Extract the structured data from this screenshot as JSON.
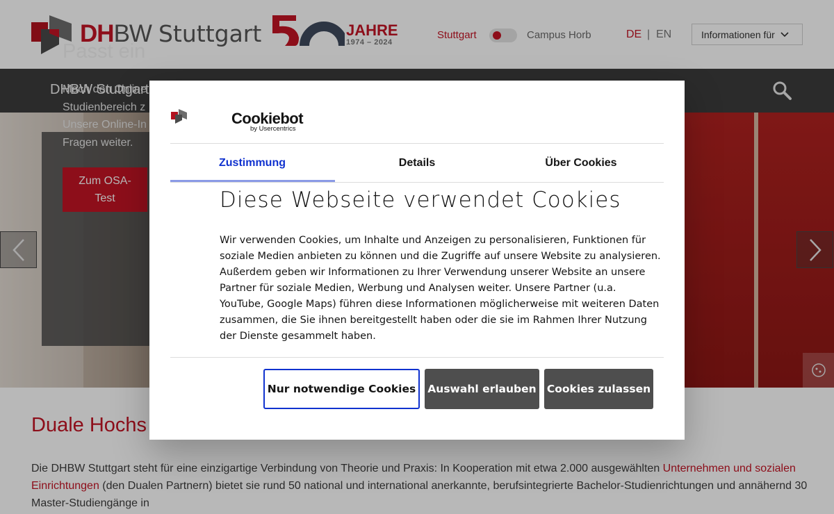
{
  "header": {
    "brand_dh": "DH",
    "brand_bw": "BW",
    "brand_city": "Stuttgart",
    "jubilee_label": "JAHRE",
    "jubilee_years": "1974 – 2024",
    "campus_stuttgart": "Stuttgart",
    "campus_horb": "Campus Horb",
    "lang_de": "DE",
    "lang_sep": "|",
    "lang_en": "EN",
    "info_dropdown": "Informationen für"
  },
  "nav": {
    "title": "DHBW Stuttgart"
  },
  "hero": {
    "title": "Passt ein",
    "lines": [
      "Mach den Online",
      "Studienbereich z",
      "Unsere Online-In",
      "Fragen weiter."
    ],
    "button_line1": "Zum OSA-",
    "button_line2": "Test"
  },
  "content": {
    "title": "Duale Hochs",
    "text_part1": "Die DHBW Stuttgart steht für eine einzigartige Verbindung von Theorie und Praxis: In Kooperation mit etwa 2.000 ausgewählten ",
    "text_link": "Unternehmen und sozialen Einrichtungen",
    "text_part2": " (den Dualen Partnern) bietet sie rund 50 national und international anerkannte, berufsintegrierte Bachelor-Studienrichtungen und annähernd 30 Master-Studiengänge in"
  },
  "cookie_dialog": {
    "brand": "Cookiebot",
    "brand_sub": "by Usercentrics",
    "tabs": [
      "Zustimmung",
      "Details",
      "Über Cookies"
    ],
    "heading": "Diese Webseite verwendet Cookies",
    "body": "Wir verwenden Cookies, um Inhalte und Anzeigen zu personalisieren, Funktionen für soziale Medien anbieten zu können und die Zugriffe auf unsere Website zu analysieren. Außerdem geben wir Informationen zu Ihrer Verwendung unserer Website an unsere Partner für soziale Medien, Werbung und Analysen weiter. Unsere Partner (u.a. YouTube, Google Maps) führen diese Informationen möglicherweise mit weiteren Daten zusammen, die Sie ihnen bereitgestellt haben oder die sie im Rahmen Ihrer Nutzung der Dienste gesammelt haben.",
    "btn_necessary": "Nur notwendige Cookies",
    "btn_selection": "Auswahl erlauben",
    "btn_all": "Cookies zulassen"
  },
  "colors": {
    "brand_red": "#c41424",
    "nav_dark": "#3c3c3c",
    "cookiebot_blue": "#1032cf",
    "button_gray": "#4e4e4e"
  },
  "icons": {
    "logo": "dhbw-logo-icon",
    "search": "search-icon",
    "chevron": "chevron-down-icon",
    "prev": "chevron-left-icon",
    "next": "chevron-right-icon",
    "cookie_settings": "cookie-settings-icon"
  }
}
